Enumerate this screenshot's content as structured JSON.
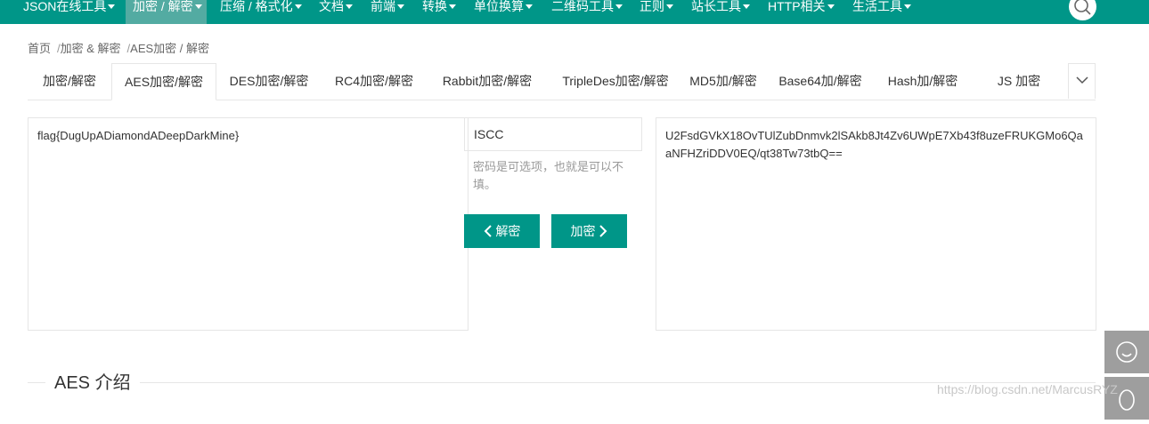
{
  "nav": {
    "items": [
      {
        "label": "JSON在线工具"
      },
      {
        "label": "加密 / 解密"
      },
      {
        "label": "压缩 / 格式化"
      },
      {
        "label": "文档"
      },
      {
        "label": "前端"
      },
      {
        "label": "转换"
      },
      {
        "label": "单位换算"
      },
      {
        "label": "二维码工具"
      },
      {
        "label": "正则"
      },
      {
        "label": "站长工具"
      },
      {
        "label": "HTTP相关"
      },
      {
        "label": "生活工具"
      }
    ],
    "active_index": 1
  },
  "breadcrumb": [
    "首页",
    "加密 & 解密",
    "AES加密 / 解密"
  ],
  "breadcrumb_sep": "/",
  "tabs": [
    {
      "label": "加密/解密"
    },
    {
      "label": "AES加密/解密"
    },
    {
      "label": "DES加密/解密"
    },
    {
      "label": "RC4加密/解密"
    },
    {
      "label": "Rabbit加密/解密"
    },
    {
      "label": "TripleDes加密/解密"
    },
    {
      "label": "MD5加/解密"
    },
    {
      "label": "Base64加/解密"
    },
    {
      "label": "Hash加/解密"
    },
    {
      "label": "JS 加密"
    }
  ],
  "active_tab_index": 1,
  "tool": {
    "plaintext": "flag{DugUpADiamondADeepDarkMine}",
    "key": "ISCC",
    "key_hint": "密码是可选项，也就是可以不填。",
    "decrypt_label": "解密",
    "encrypt_label": "加密",
    "ciphertext": "U2FsdGVkX18OvTUlZubDnmvk2lSAkb8Jt4Zv6UWpE7Xb43f8uzeFRUKGMo6QaaNFHZriDDV0EQ/qt38Tw73tbQ=="
  },
  "section_title": "AES 介绍",
  "watermark": "https://blog.csdn.net/MarcusRYZ",
  "colors": {
    "brand": "#009688",
    "nav_active": "#53aba2",
    "side_button": "#9e9e9e"
  }
}
